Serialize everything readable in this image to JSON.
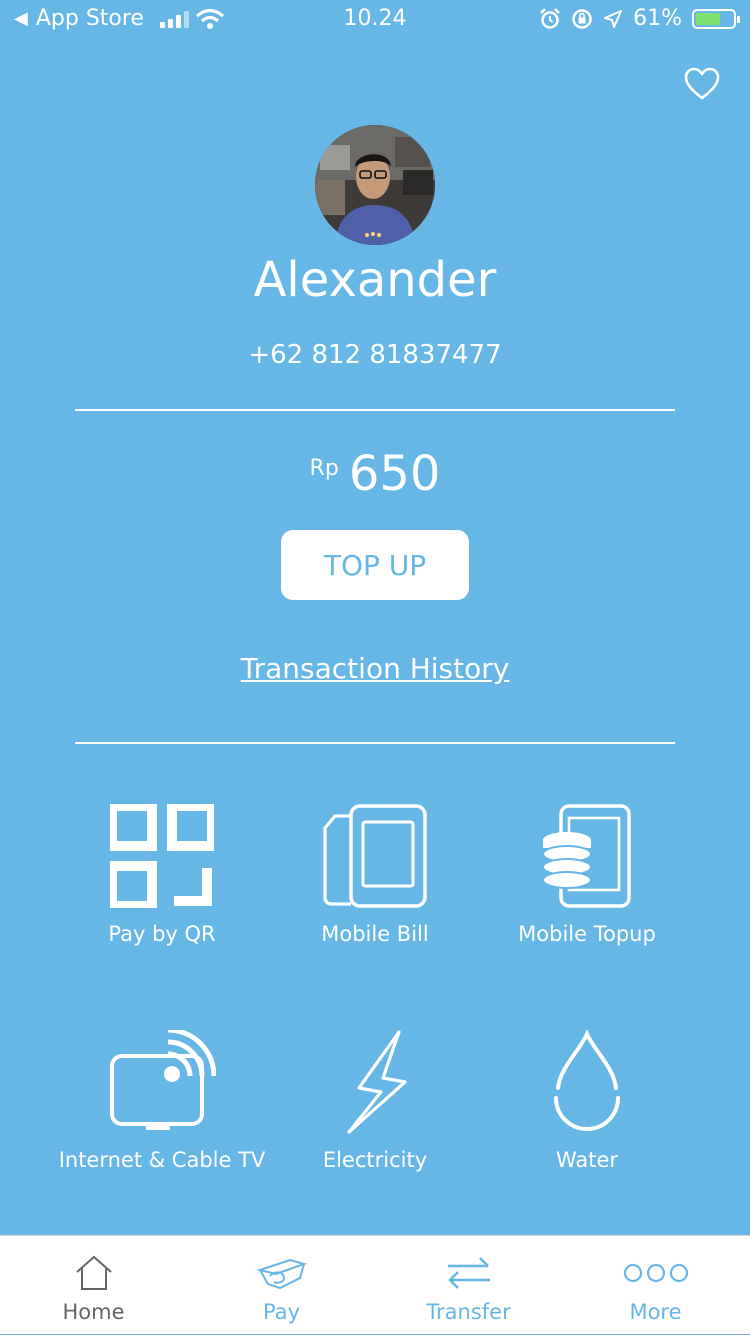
{
  "status_bar": {
    "back_label": "App Store",
    "time": "10.24",
    "battery": "61%"
  },
  "profile": {
    "name": "Alexander",
    "phone": "+62 812 81837477"
  },
  "wallet": {
    "currency": "Rp",
    "amount": "650",
    "topup_label": "TOP UP",
    "history_label": "Transaction History"
  },
  "services": [
    {
      "label": "Pay by QR",
      "icon": "qr-icon"
    },
    {
      "label": "Mobile Bill",
      "icon": "mobile-bill-icon"
    },
    {
      "label": "Mobile Topup",
      "icon": "mobile-topup-icon"
    },
    {
      "label": "Internet & Cable TV",
      "icon": "tv-wifi-icon"
    },
    {
      "label": "Electricity",
      "icon": "lightning-icon"
    },
    {
      "label": "Water",
      "icon": "water-drop-icon"
    }
  ],
  "tabbar": {
    "items": [
      {
        "label": "Home",
        "icon": "home-icon"
      },
      {
        "label": "Pay",
        "icon": "pay-card-icon"
      },
      {
        "label": "Transfer",
        "icon": "transfer-icon"
      },
      {
        "label": "More",
        "icon": "more-icon"
      }
    ]
  },
  "colors": {
    "background": "#66b6e6",
    "accent": "#66b6e6",
    "tab_inactive": "#666666"
  }
}
